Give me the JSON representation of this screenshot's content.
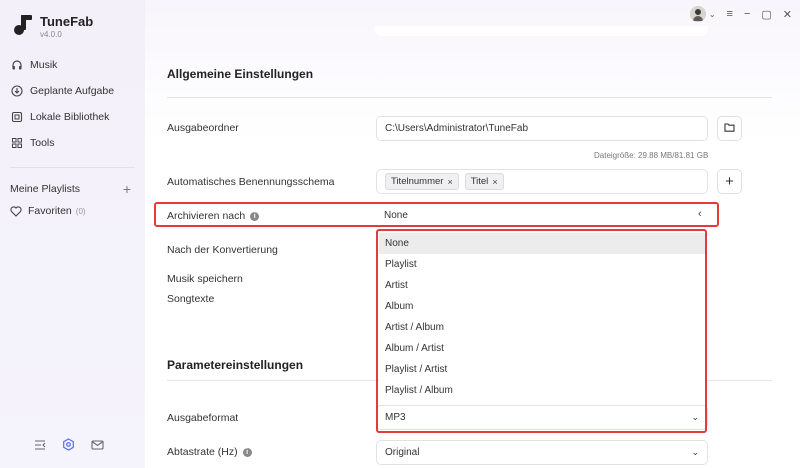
{
  "app": {
    "name": "TuneFab",
    "version": "v4.0.0"
  },
  "sidebar": {
    "items": [
      {
        "label": "Musik",
        "icon": "headphones-icon"
      },
      {
        "label": "Geplante Aufgabe",
        "icon": "download-circle-icon"
      },
      {
        "label": "Lokale Bibliothek",
        "icon": "library-icon"
      },
      {
        "label": "Tools",
        "icon": "grid-icon"
      }
    ],
    "playlists_label": "Meine Playlists",
    "favorites_label": "Favoriten",
    "favorites_count": "(0)"
  },
  "general": {
    "title": "Allgemeine Einstellungen",
    "output_folder_label": "Ausgabeordner",
    "output_folder_value": "C:\\Users\\Administrator\\TuneFab",
    "file_size": "Dateigröße: 29.88 MB/81.81 GB",
    "naming_label": "Automatisches Benennungsschema",
    "naming_chips": [
      "Titelnummer",
      "Titel"
    ],
    "archive_label": "Archivieren nach",
    "archive_value": "None",
    "after_conversion_label": "Nach der Konvertierung",
    "save_music_label": "Musik speichern",
    "lyrics_label": "Songtexte"
  },
  "archive_options": [
    "None",
    "Playlist",
    "Artist",
    "Album",
    "Artist / Album",
    "Album / Artist",
    "Playlist / Artist",
    "Playlist / Album"
  ],
  "params": {
    "title": "Parametereinstellungen",
    "format_label": "Ausgabeformat",
    "format_value": "MP3",
    "samplerate_label": "Abtastrate (Hz)",
    "samplerate_value": "Original"
  },
  "colors": {
    "highlight": "#e23b3b"
  }
}
